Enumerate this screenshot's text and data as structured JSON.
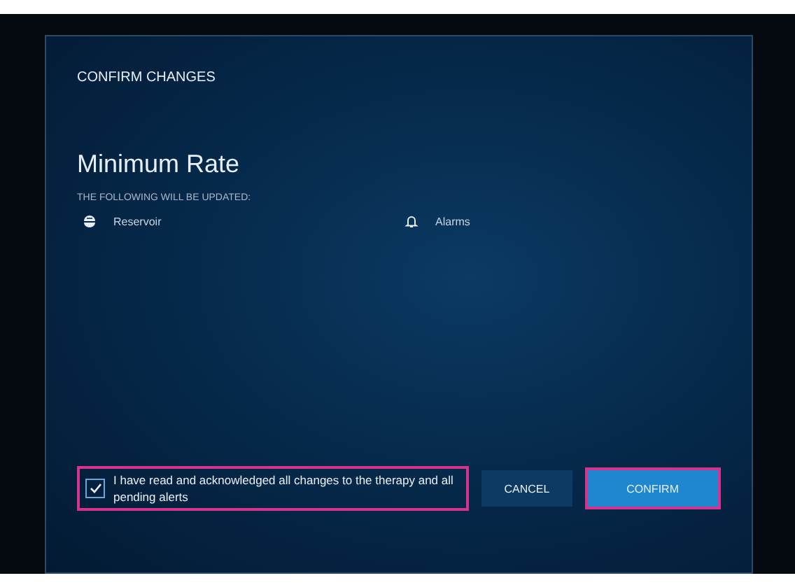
{
  "dialog": {
    "title": "CONFIRM CHANGES",
    "heading": "Minimum Rate",
    "subheading": "THE FOLLOWING WILL BE UPDATED:",
    "updated_items": [
      {
        "kind": "reservoir",
        "label": "Reservoir"
      },
      {
        "kind": "alarms",
        "label": "Alarms"
      }
    ],
    "acknowledgement": {
      "text": "I have read and acknowledged all changes to the therapy and all pending alerts",
      "checked": true,
      "highlighted": true
    },
    "buttons": [
      {
        "kind": "secondary",
        "label": "CANCEL",
        "highlighted": false
      },
      {
        "kind": "primary",
        "label": "CONFIRM",
        "highlighted": true
      }
    ]
  }
}
